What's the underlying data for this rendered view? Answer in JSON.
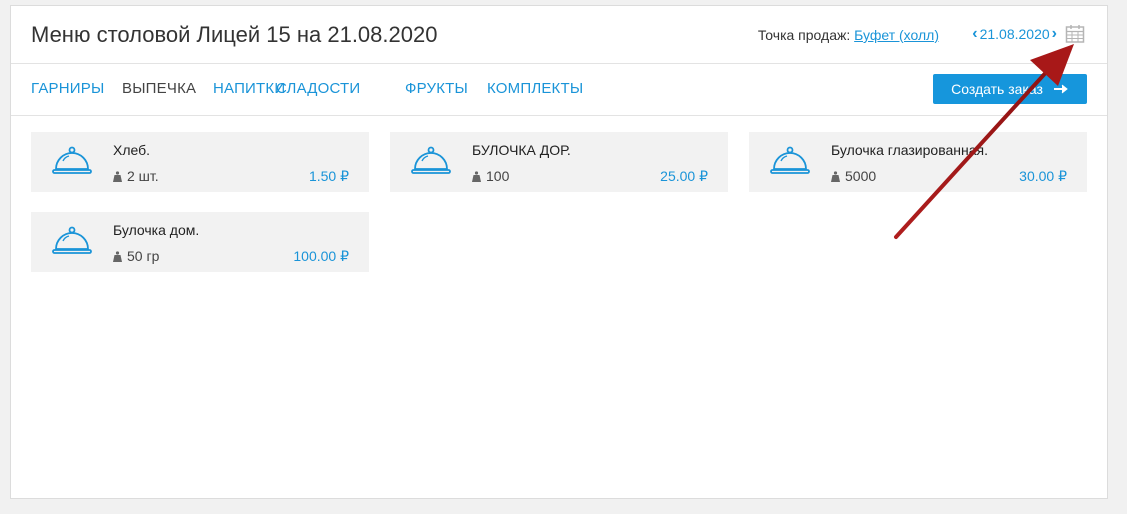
{
  "header": {
    "title": "Меню столовой Лицей 15 на 21.08.2020",
    "sale_point_label": "Точка продаж:",
    "sale_point_value": "Буфет (холл)",
    "date": "21.08.2020",
    "calendar_icon": "calendar-icon",
    "prev_icon": "chevron-left-icon",
    "next_icon": "chevron-right-icon"
  },
  "tabs": [
    {
      "label": "ГАРНИРЫ",
      "active": false
    },
    {
      "label": "ВЫПЕЧКА",
      "active": true
    },
    {
      "label": "НАПИТКИ",
      "active": false
    },
    {
      "label": "СЛАДОСТИ",
      "active": false
    },
    {
      "label": "ФРУКТЫ",
      "active": false
    },
    {
      "label": "КОМПЛЕКТЫ",
      "active": false
    }
  ],
  "order_button": {
    "label": "Создать заказ",
    "icon": "arrow-right-icon"
  },
  "items": [
    {
      "name": "Хлеб.",
      "weight": "2 шт.",
      "price": "1.50 ₽"
    },
    {
      "name": "БУЛОЧКА ДОР.",
      "weight": "100",
      "price": "25.00 ₽"
    },
    {
      "name": "Булочка глазированная.",
      "weight": "5000",
      "price": "30.00 ₽"
    },
    {
      "name": "Булочка дом.",
      "weight": "50 гр",
      "price": "100.00 ₽"
    }
  ],
  "colors": {
    "accent": "#1a94d8",
    "button": "#1696dc",
    "card_bg": "#f2f2f2",
    "annotation_arrow": "#b01e1e"
  }
}
